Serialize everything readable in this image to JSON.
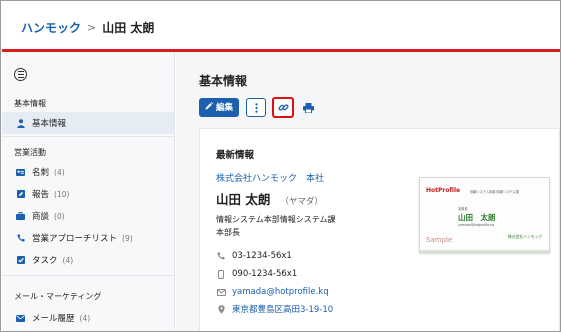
{
  "header": {
    "breadcrumb_root": "ハンモック",
    "breadcrumb_sep": ">",
    "breadcrumb_current": "山田 太朗"
  },
  "sidebar": {
    "sections": [
      {
        "label": "基本情報"
      },
      {
        "label": "営業活動"
      },
      {
        "label": "メール・マーケティング"
      }
    ],
    "items": [
      {
        "label": "基本情報",
        "count": "",
        "icon": "person-icon"
      },
      {
        "label": "名刺",
        "count": "(4)",
        "icon": "business-card-icon"
      },
      {
        "label": "報告",
        "count": "(10)",
        "icon": "edit-report-icon"
      },
      {
        "label": "商談",
        "count": "(0)",
        "icon": "deal-icon"
      },
      {
        "label": "営業アプローチリスト",
        "count": "(9)",
        "icon": "phone-icon"
      },
      {
        "label": "タスク",
        "count": "(4)",
        "icon": "checkbox-icon"
      },
      {
        "label": "メール履歴",
        "count": "(4)",
        "icon": "mail-icon"
      }
    ]
  },
  "main": {
    "page_title": "基本情報",
    "edit_label": "編集",
    "card": {
      "title": "最新情報",
      "company": "株式会社ハンモック　本社",
      "name": "山田 太朗",
      "kana": "（ヤマダ）",
      "department": "情報システム本部情報システム課",
      "position": "本部長",
      "phone": "03-1234-56x1",
      "mobile": "090-1234-56x1",
      "email": "yamada@hotprofile.kq",
      "address": "東京都豊島区高田3-19-10"
    },
    "bizcard": {
      "logo": "HotProfile",
      "dept_line": "情報システム本部 情報システム課",
      "role_line": "本部長",
      "name": "山田　太朗",
      "email_line": "yamada@hotprofile.kq",
      "company_line": "株式会社ハンモック",
      "sample": "Sample"
    }
  },
  "colors": {
    "accent_blue": "#1b5fae",
    "brand_red": "#d81d1d",
    "highlight_red": "#e01010"
  }
}
